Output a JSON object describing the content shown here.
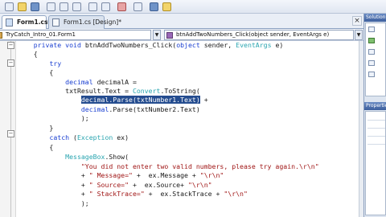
{
  "toolbar": {
    "icons": [
      "new-item-icon",
      "open-icon",
      "save-icon",
      "cut-icon",
      "copy-icon",
      "paste-icon",
      "undo-icon",
      "redo-icon",
      "start-debug-icon",
      "find-icon",
      "solution-icon",
      "properties-icon"
    ]
  },
  "tabs": [
    {
      "label": "Form1.cs*",
      "active": true
    },
    {
      "label": "Form1.cs [Design]*",
      "active": false
    }
  ],
  "tab_close": "×",
  "navigation": {
    "class_dropdown": "TryCatch_Intro_01.Form1",
    "member_dropdown": "btnAddTwoNumbers_Click(object sender, EventArgs e)",
    "dropdown_glyph": "▼"
  },
  "editor": {
    "collapse_glyph": "−",
    "lines": [
      {
        "segments": [
          {
            "t": "    "
          },
          {
            "t": "private",
            "c": "kw"
          },
          {
            "t": " "
          },
          {
            "t": "void",
            "c": "kw"
          },
          {
            "t": " btnAddTwoNumbers_Click("
          },
          {
            "t": "object",
            "c": "kw"
          },
          {
            "t": " sender, "
          },
          {
            "t": "EventArgs",
            "c": "ty"
          },
          {
            "t": " e)"
          }
        ]
      },
      {
        "segments": [
          {
            "t": "    {"
          }
        ]
      },
      {
        "segments": [
          {
            "t": "        "
          },
          {
            "t": "try",
            "c": "kw"
          }
        ]
      },
      {
        "segments": [
          {
            "t": "        {"
          }
        ]
      },
      {
        "segments": [
          {
            "t": "            "
          },
          {
            "t": "decimal",
            "c": "kw"
          },
          {
            "t": " decimalA ="
          }
        ]
      },
      {
        "segments": [
          {
            "t": "            txtResult.Text = "
          },
          {
            "t": "Convert",
            "c": "ty"
          },
          {
            "t": ".ToString("
          }
        ]
      },
      {
        "segments": [
          {
            "t": "                "
          },
          {
            "t": "decimal.Parse(txtNumber1.Text)",
            "c": "hl"
          },
          {
            "t": " +"
          }
        ]
      },
      {
        "segments": [
          {
            "t": "                "
          },
          {
            "t": "decimal",
            "c": "kw"
          },
          {
            "t": ".Parse(txtNumber2.Text)"
          }
        ]
      },
      {
        "segments": [
          {
            "t": "                );"
          }
        ]
      },
      {
        "segments": [
          {
            "t": "        }"
          }
        ]
      },
      {
        "segments": [
          {
            "t": "        "
          },
          {
            "t": "catch",
            "c": "kw"
          },
          {
            "t": " ("
          },
          {
            "t": "Exception",
            "c": "ty"
          },
          {
            "t": " ex)"
          }
        ]
      },
      {
        "segments": [
          {
            "t": "        {"
          }
        ]
      },
      {
        "segments": [
          {
            "t": "            "
          },
          {
            "t": "MessageBox",
            "c": "ty"
          },
          {
            "t": ".Show("
          }
        ]
      },
      {
        "segments": [
          {
            "t": "                "
          },
          {
            "t": "\"You did not enter two valid numbers, please try again.\\r\\n\"",
            "c": "str"
          }
        ]
      },
      {
        "segments": [
          {
            "t": "                + "
          },
          {
            "t": "\" Message=\"",
            "c": "str"
          },
          {
            "t": " +  ex.Message + "
          },
          {
            "t": "\"\\r\\n\"",
            "c": "str"
          }
        ]
      },
      {
        "segments": [
          {
            "t": "                + "
          },
          {
            "t": "\" Source=\"",
            "c": "str"
          },
          {
            "t": " +  ex.Source+ "
          },
          {
            "t": "\"\\r\\n\"",
            "c": "str"
          }
        ]
      },
      {
        "segments": [
          {
            "t": "                + "
          },
          {
            "t": "\" StackTrace=\"",
            "c": "str"
          },
          {
            "t": " +  ex.StackTrace + "
          },
          {
            "t": "\"\\r\\n\"",
            "c": "str"
          }
        ]
      },
      {
        "segments": [
          {
            "t": "                );"
          }
        ]
      },
      {
        "segments": [
          {
            "t": ""
          }
        ]
      },
      {
        "segments": [
          {
            "t": "        }"
          }
        ]
      }
    ]
  },
  "right_panel": {
    "solution_title": "Solution",
    "properties_title": "Properties"
  },
  "colors": {
    "keyword": "#1a3fd1",
    "type": "#2aa5b0",
    "string": "#a01616",
    "selection": "#244c8f"
  }
}
